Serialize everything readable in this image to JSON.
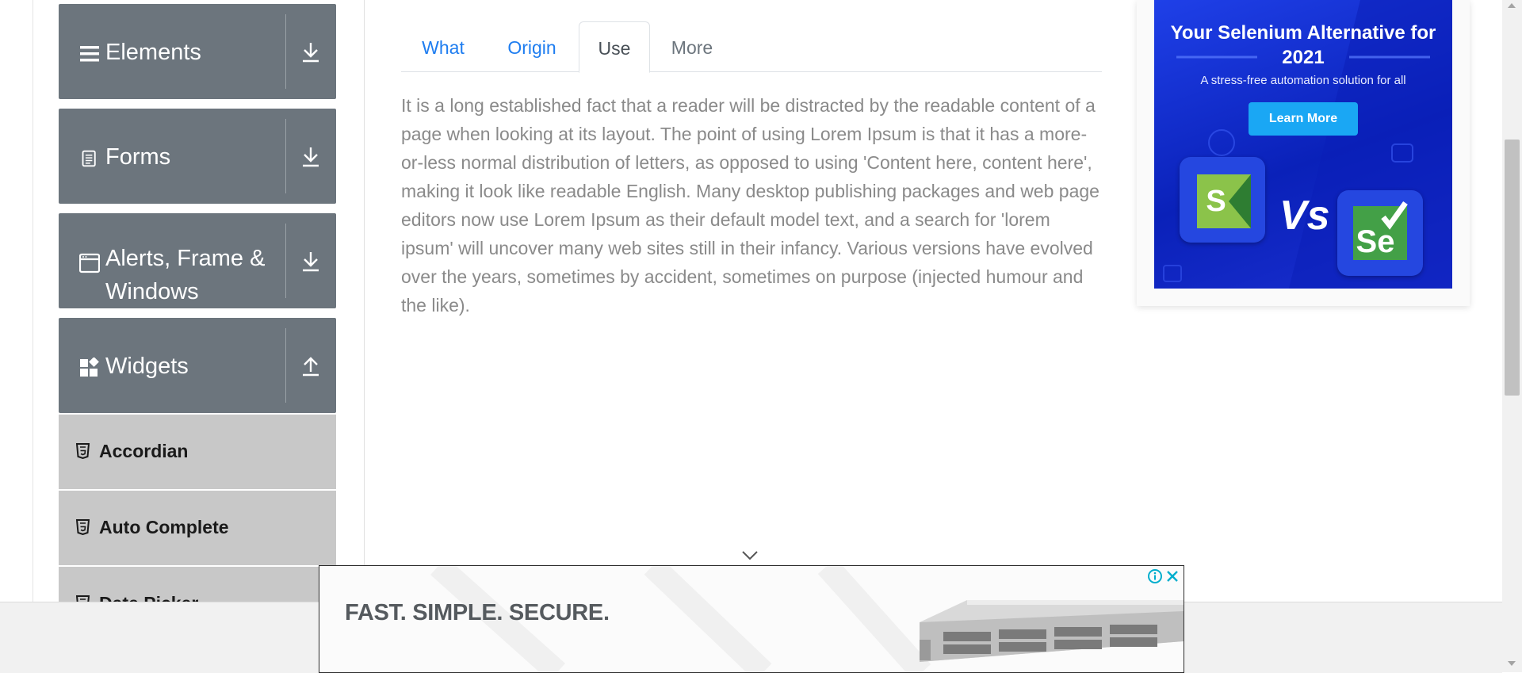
{
  "sidebar": {
    "groups": [
      {
        "label": "Elements",
        "icon": "list-icon",
        "arrow": "download-arrow-icon"
      },
      {
        "label": "Forms",
        "icon": "document-icon",
        "arrow": "download-arrow-icon"
      },
      {
        "label": "Alerts, Frame & Windows",
        "icon": "window-icon",
        "arrow": "download-arrow-icon"
      },
      {
        "label": "Widgets",
        "icon": "widgets-icon",
        "arrow": "upload-arrow-icon"
      }
    ],
    "items": [
      {
        "label": "Accordian",
        "icon": "html5-icon"
      },
      {
        "label": "Auto Complete",
        "icon": "html5-icon"
      },
      {
        "label": "Date Picker",
        "icon": "html5-icon"
      }
    ]
  },
  "tabs": [
    {
      "label": "What",
      "state": "link"
    },
    {
      "label": "Origin",
      "state": "link"
    },
    {
      "label": "Use",
      "state": "active"
    },
    {
      "label": "More",
      "state": "disabled"
    }
  ],
  "content": {
    "paragraph": "It is a long established fact that a reader will be distracted by the readable content of a page when looking at its layout. The point of using Lorem Ipsum is that it has a more-or-less normal distribution of letters, as opposed to using 'Content here, content here', making it look like readable English. Many desktop publishing packages and web page editors now use Lorem Ipsum as their default model text, and a search for 'lorem ipsum' will uncover many web sites still in their infancy. Various versions have evolved over the years, sometimes by accident, sometimes on purpose (injected humour and the like)."
  },
  "side_ad": {
    "title": "Your Selenium Alternative for 2021",
    "subtitle": "A stress-free automation solution for all",
    "button": "Learn More",
    "vs": "Vs",
    "logo_left": "S",
    "logo_right": "Se"
  },
  "bottom_ad": {
    "headline": "FAST. SIMPLE. SECURE."
  },
  "colors": {
    "sidebar_group": "#6c757d",
    "sidebar_item": "#c8c8c8",
    "tab_link": "#1e7df0",
    "ad_blue": "#0a21b9",
    "ad_button": "#1aa7f4",
    "adchoice": "#00aecd"
  }
}
